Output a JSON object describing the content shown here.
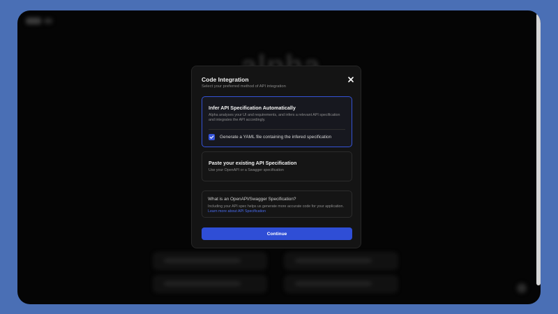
{
  "background": {
    "logo_text": "alpha"
  },
  "modal": {
    "title": "Code Integration",
    "subtitle": "Select your preferred method of API integration",
    "options": [
      {
        "title": "Infer API Specification Automatically",
        "description": "Alpha analyses your UI and requirements, and infers a relevant API specification and integrates the API accordingly.",
        "selected": true,
        "checkbox_label": "Generate a YAML file containing the infered specification",
        "checkbox_checked": true
      },
      {
        "title": "Paste your existing API Specification",
        "description": "Use your OpenAPI or a Swagger specification",
        "selected": false
      }
    ],
    "info": {
      "title": "What is an OpenAPI/Swagger Specification?",
      "description": "Including your API spec helps us generate more accurate code for your application.",
      "link_text": "Learn more about API Specification"
    },
    "continue_label": "Continue"
  },
  "colors": {
    "accent": "#3553d8",
    "page_background": "#4a6fb5",
    "app_background": "#050505",
    "modal_background": "#141414"
  },
  "icons": {
    "close": "close-icon",
    "check": "check-icon"
  }
}
